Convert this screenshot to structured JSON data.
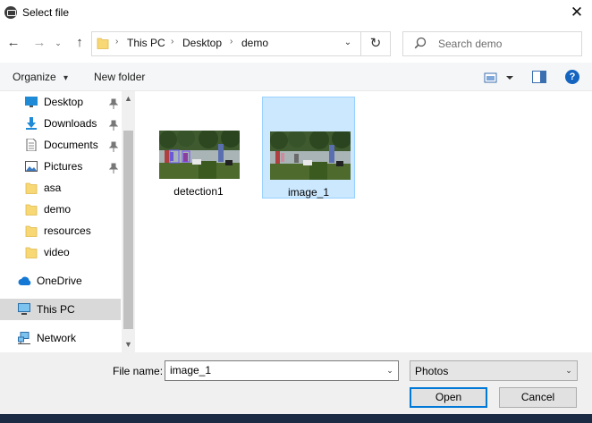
{
  "window": {
    "title": "Select file",
    "close_glyph": "✕"
  },
  "nav": {
    "back_glyph": "←",
    "forward_glyph": "→",
    "recent_glyph": "⌄",
    "up_glyph": "↑",
    "refresh_glyph": "↻",
    "dropdown_glyph": "⌄"
  },
  "address": {
    "crumbs": [
      "This PC",
      "Desktop",
      "demo"
    ],
    "separator": "›"
  },
  "search": {
    "placeholder": "Search demo"
  },
  "toolbar": {
    "organize_label": "Organize",
    "organize_caret": "▾",
    "new_folder_label": "New folder",
    "help_label": "?"
  },
  "sidebar": {
    "items": [
      {
        "label": "Desktop",
        "icon": "desktop-icon",
        "pinned": true
      },
      {
        "label": "Downloads",
        "icon": "download-icon",
        "pinned": true
      },
      {
        "label": "Documents",
        "icon": "document-icon",
        "pinned": true
      },
      {
        "label": "Pictures",
        "icon": "pictures-icon",
        "pinned": true
      },
      {
        "label": "asa",
        "icon": "folder-icon",
        "pinned": false
      },
      {
        "label": "demo",
        "icon": "folder-icon",
        "pinned": false
      },
      {
        "label": "resources",
        "icon": "folder-icon",
        "pinned": false
      },
      {
        "label": "video",
        "icon": "folder-icon",
        "pinned": false
      },
      {
        "label": "OneDrive",
        "icon": "cloud-icon",
        "pinned": false
      },
      {
        "label": "This PC",
        "icon": "computer-icon",
        "pinned": false,
        "selected": true
      },
      {
        "label": "Network",
        "icon": "network-icon",
        "pinned": false
      }
    ],
    "pin_glyph": "📌",
    "scroll_up_glyph": "▲",
    "scroll_down_glyph": "▼"
  },
  "files": [
    {
      "name": "detection1",
      "selected": false
    },
    {
      "name": "image_1",
      "selected": true
    }
  ],
  "bottom": {
    "filename_label": "File name:",
    "filename_value": "image_1",
    "filetype_value": "Photos",
    "open_label": "Open",
    "cancel_label": "Cancel",
    "caret_glyph": "⌄"
  },
  "colors": {
    "selection_bg": "#cce8ff",
    "accent": "#0078d7"
  }
}
